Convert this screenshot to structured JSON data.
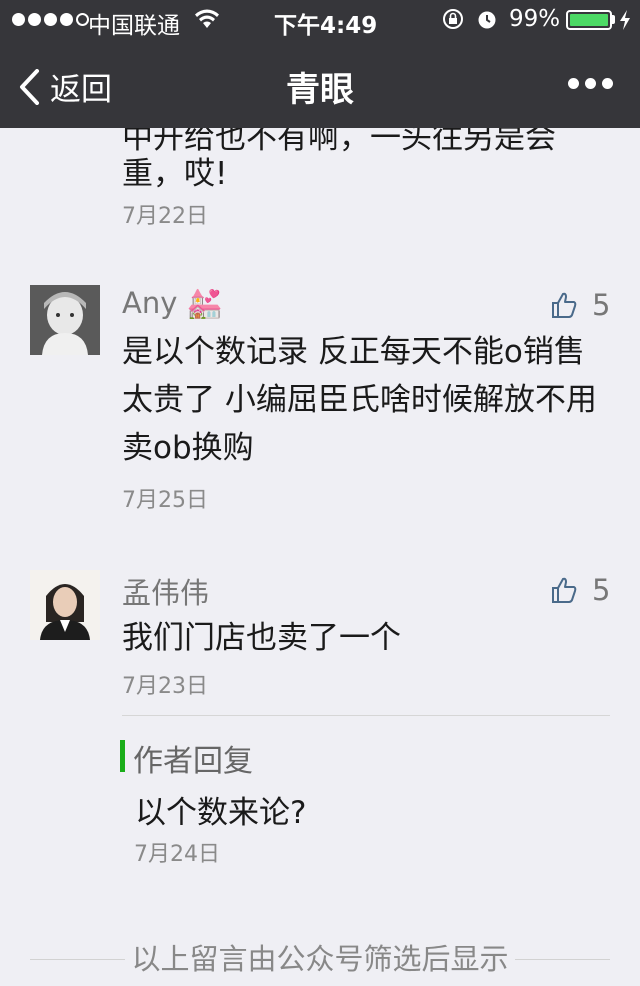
{
  "status_bar": {
    "carrier": "中国联通",
    "time": "下午4:49",
    "battery": "99%",
    "battery_level": 0.99
  },
  "nav": {
    "back_label": "返回",
    "title": "青眼"
  },
  "previous_comment": {
    "text_line_partial": "中开给也不有啊，一头往另是会",
    "text_last_line": "重，哎!",
    "date": "7月22日"
  },
  "comments": [
    {
      "name": "Any 💒",
      "likes": "5",
      "text": "是以个数记录 反正每天不能o销售 太贵了 小编屈臣氏啥时候解放不用卖ob换购",
      "date": "7月25日"
    },
    {
      "name": "孟伟伟",
      "likes": "5",
      "text": "我们门店也卖了一个",
      "date": "7月23日",
      "reply": {
        "title": "作者回复",
        "text": "以个数来论?",
        "date": "7月24日"
      }
    }
  ],
  "footer": {
    "text": "以上留言由公众号筛选后显示"
  },
  "colors": {
    "nav_bg": "#36363a",
    "page_bg": "#efeff4",
    "like_icon": "#4a6a8a",
    "reply_accent": "#1aad19",
    "battery_green": "#4cd964"
  }
}
